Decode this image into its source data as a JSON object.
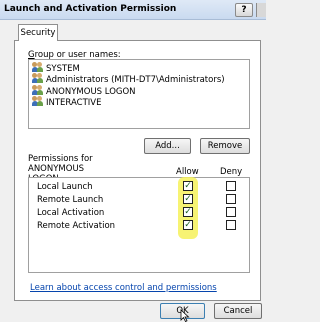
{
  "window": {
    "title": "Launch and Activation Permission",
    "help_label": "?"
  },
  "tabs": [
    {
      "label": "Security"
    }
  ],
  "groups": {
    "label": "Group or user names:",
    "items": [
      {
        "label": "SYSTEM",
        "icon": "users-icon"
      },
      {
        "label": "Administrators (MITH-DT7\\Administrators)",
        "icon": "users-icon"
      },
      {
        "label": "ANONYMOUS LOGON",
        "icon": "users-icon",
        "selected": true
      },
      {
        "label": "INTERACTIVE",
        "icon": "users-icon"
      }
    ]
  },
  "buttons": {
    "add": "Add...",
    "remove": "Remove",
    "ok": "OK",
    "cancel": "Cancel"
  },
  "permissions": {
    "label_line1": "Permissions for ANONYMOUS",
    "label_line2": "LOGON",
    "allow_header": "Allow",
    "deny_header": "Deny",
    "rows": [
      {
        "name": "Local Launch",
        "allow": true,
        "deny": false
      },
      {
        "name": "Remote Launch",
        "allow": true,
        "deny": false
      },
      {
        "name": "Local Activation",
        "allow": true,
        "deny": false
      },
      {
        "name": "Remote Activation",
        "allow": true,
        "deny": false
      }
    ],
    "check_glyph": "✓",
    "highlight_color": "#f6f15a"
  },
  "link": {
    "text": "Learn about access control and permissions"
  }
}
